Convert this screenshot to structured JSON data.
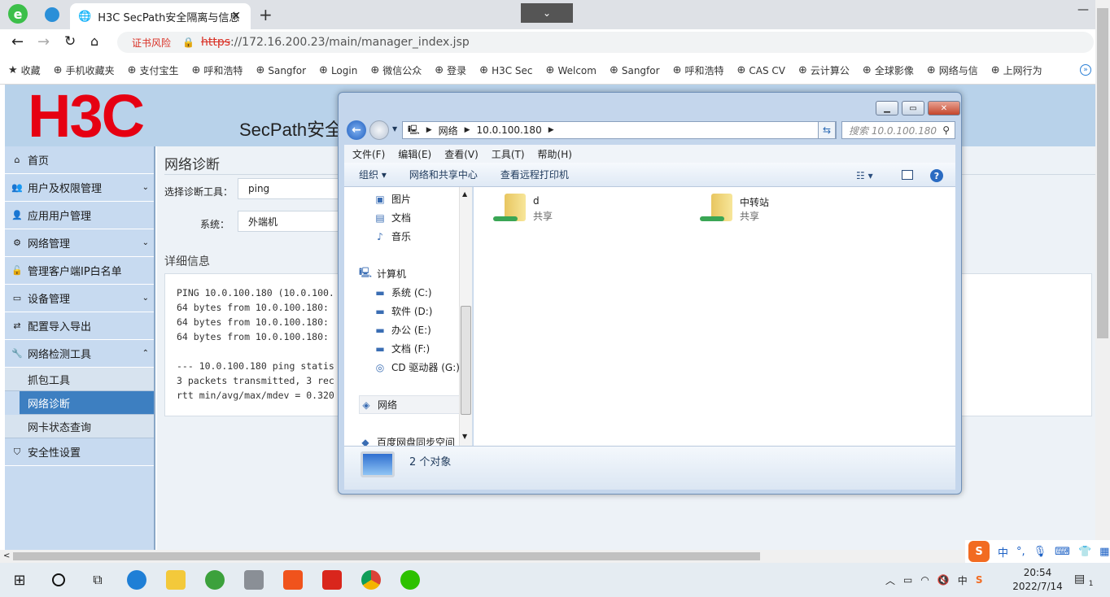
{
  "browser": {
    "tab_title": "H3C SecPath安全隔离与信息",
    "address_warning": "证书风险",
    "url_scheme": "https",
    "url_rest": "://172.16.200.23/main/manager_index.jsp",
    "bookmarks": [
      "收藏",
      "手机收藏夹",
      "支付宝生",
      "呼和浩特",
      "Sangfor",
      "Login",
      "微信公众",
      "登录",
      "H3C Sec",
      "Welcom",
      "Sangfor",
      "呼和浩特",
      "CAS CV",
      "云计算公",
      "全球影像",
      "网络与信",
      "上网行为"
    ]
  },
  "app": {
    "logo": "H3C",
    "product": "SecPath安全",
    "sidebar": [
      {
        "label": "首页",
        "icon": "home-icon",
        "chevron": ""
      },
      {
        "label": "用户及权限管理",
        "icon": "users-icon",
        "chevron": "⌄"
      },
      {
        "label": "应用用户管理",
        "icon": "user-icon",
        "chevron": ""
      },
      {
        "label": "网络管理",
        "icon": "gears-icon",
        "chevron": "⌄"
      },
      {
        "label": "管理客户端IP白名单",
        "icon": "unlock-icon",
        "chevron": ""
      },
      {
        "label": "设备管理",
        "icon": "monitor-icon",
        "chevron": "⌄"
      },
      {
        "label": "配置导入导出",
        "icon": "exchange-icon",
        "chevron": ""
      },
      {
        "label": "网络检测工具",
        "icon": "wrench-icon",
        "chevron": "⌃"
      }
    ],
    "subitems": [
      "抓包工具",
      "网络诊断",
      "网卡状态查询"
    ],
    "last_item": {
      "label": "安全性设置",
      "icon": "shield-icon"
    },
    "content": {
      "title": "网络诊断",
      "tool_label": "选择诊断工具：",
      "tool_value": "ping",
      "system_label": "系统：",
      "system_value": "外端机",
      "details_label": "详细信息",
      "console": "PING 10.0.100.180 (10.0.100.\n64 bytes from 10.0.100.180:\n64 bytes from 10.0.100.180:\n64 bytes from 10.0.100.180:\n\n--- 10.0.100.180 ping statis\n3 packets transmitted, 3 rec\nrtt min/avg/max/mdev = 0.320"
    }
  },
  "explorer": {
    "breadcrumb": [
      "网络",
      "10.0.100.180"
    ],
    "search_placeholder": "搜索 10.0.100.180",
    "menu": [
      "文件(F)",
      "编辑(E)",
      "查看(V)",
      "工具(T)",
      "帮助(H)"
    ],
    "commands": [
      "组织 ▾",
      "网络和共享中心",
      "查看远程打印机"
    ],
    "nav": [
      {
        "label": "图片",
        "icon": "pictures-icon"
      },
      {
        "label": "文档",
        "icon": "documents-icon"
      },
      {
        "label": "音乐",
        "icon": "music-icon"
      },
      {
        "label": "计算机",
        "icon": "computer-icon"
      },
      {
        "label": "系统 (C:)",
        "icon": "drive-icon"
      },
      {
        "label": "软件 (D:)",
        "icon": "drive-icon"
      },
      {
        "label": "办公 (E:)",
        "icon": "drive-icon"
      },
      {
        "label": "文档 (F:)",
        "icon": "drive-icon"
      },
      {
        "label": "CD 驱动器 (G:)",
        "icon": "cd-drive-icon"
      },
      {
        "label": "网络",
        "icon": "network-icon"
      },
      {
        "label": "百度网盘同步空间",
        "icon": "cloud-icon"
      }
    ],
    "items": [
      {
        "name": "d",
        "sub": "共享"
      },
      {
        "name": "中转站",
        "sub": "共享"
      }
    ],
    "status": "2 个对象"
  },
  "taskbar": {
    "ime": "中",
    "time": "20:54",
    "date": "2022/7/14",
    "notif_count": "1"
  }
}
